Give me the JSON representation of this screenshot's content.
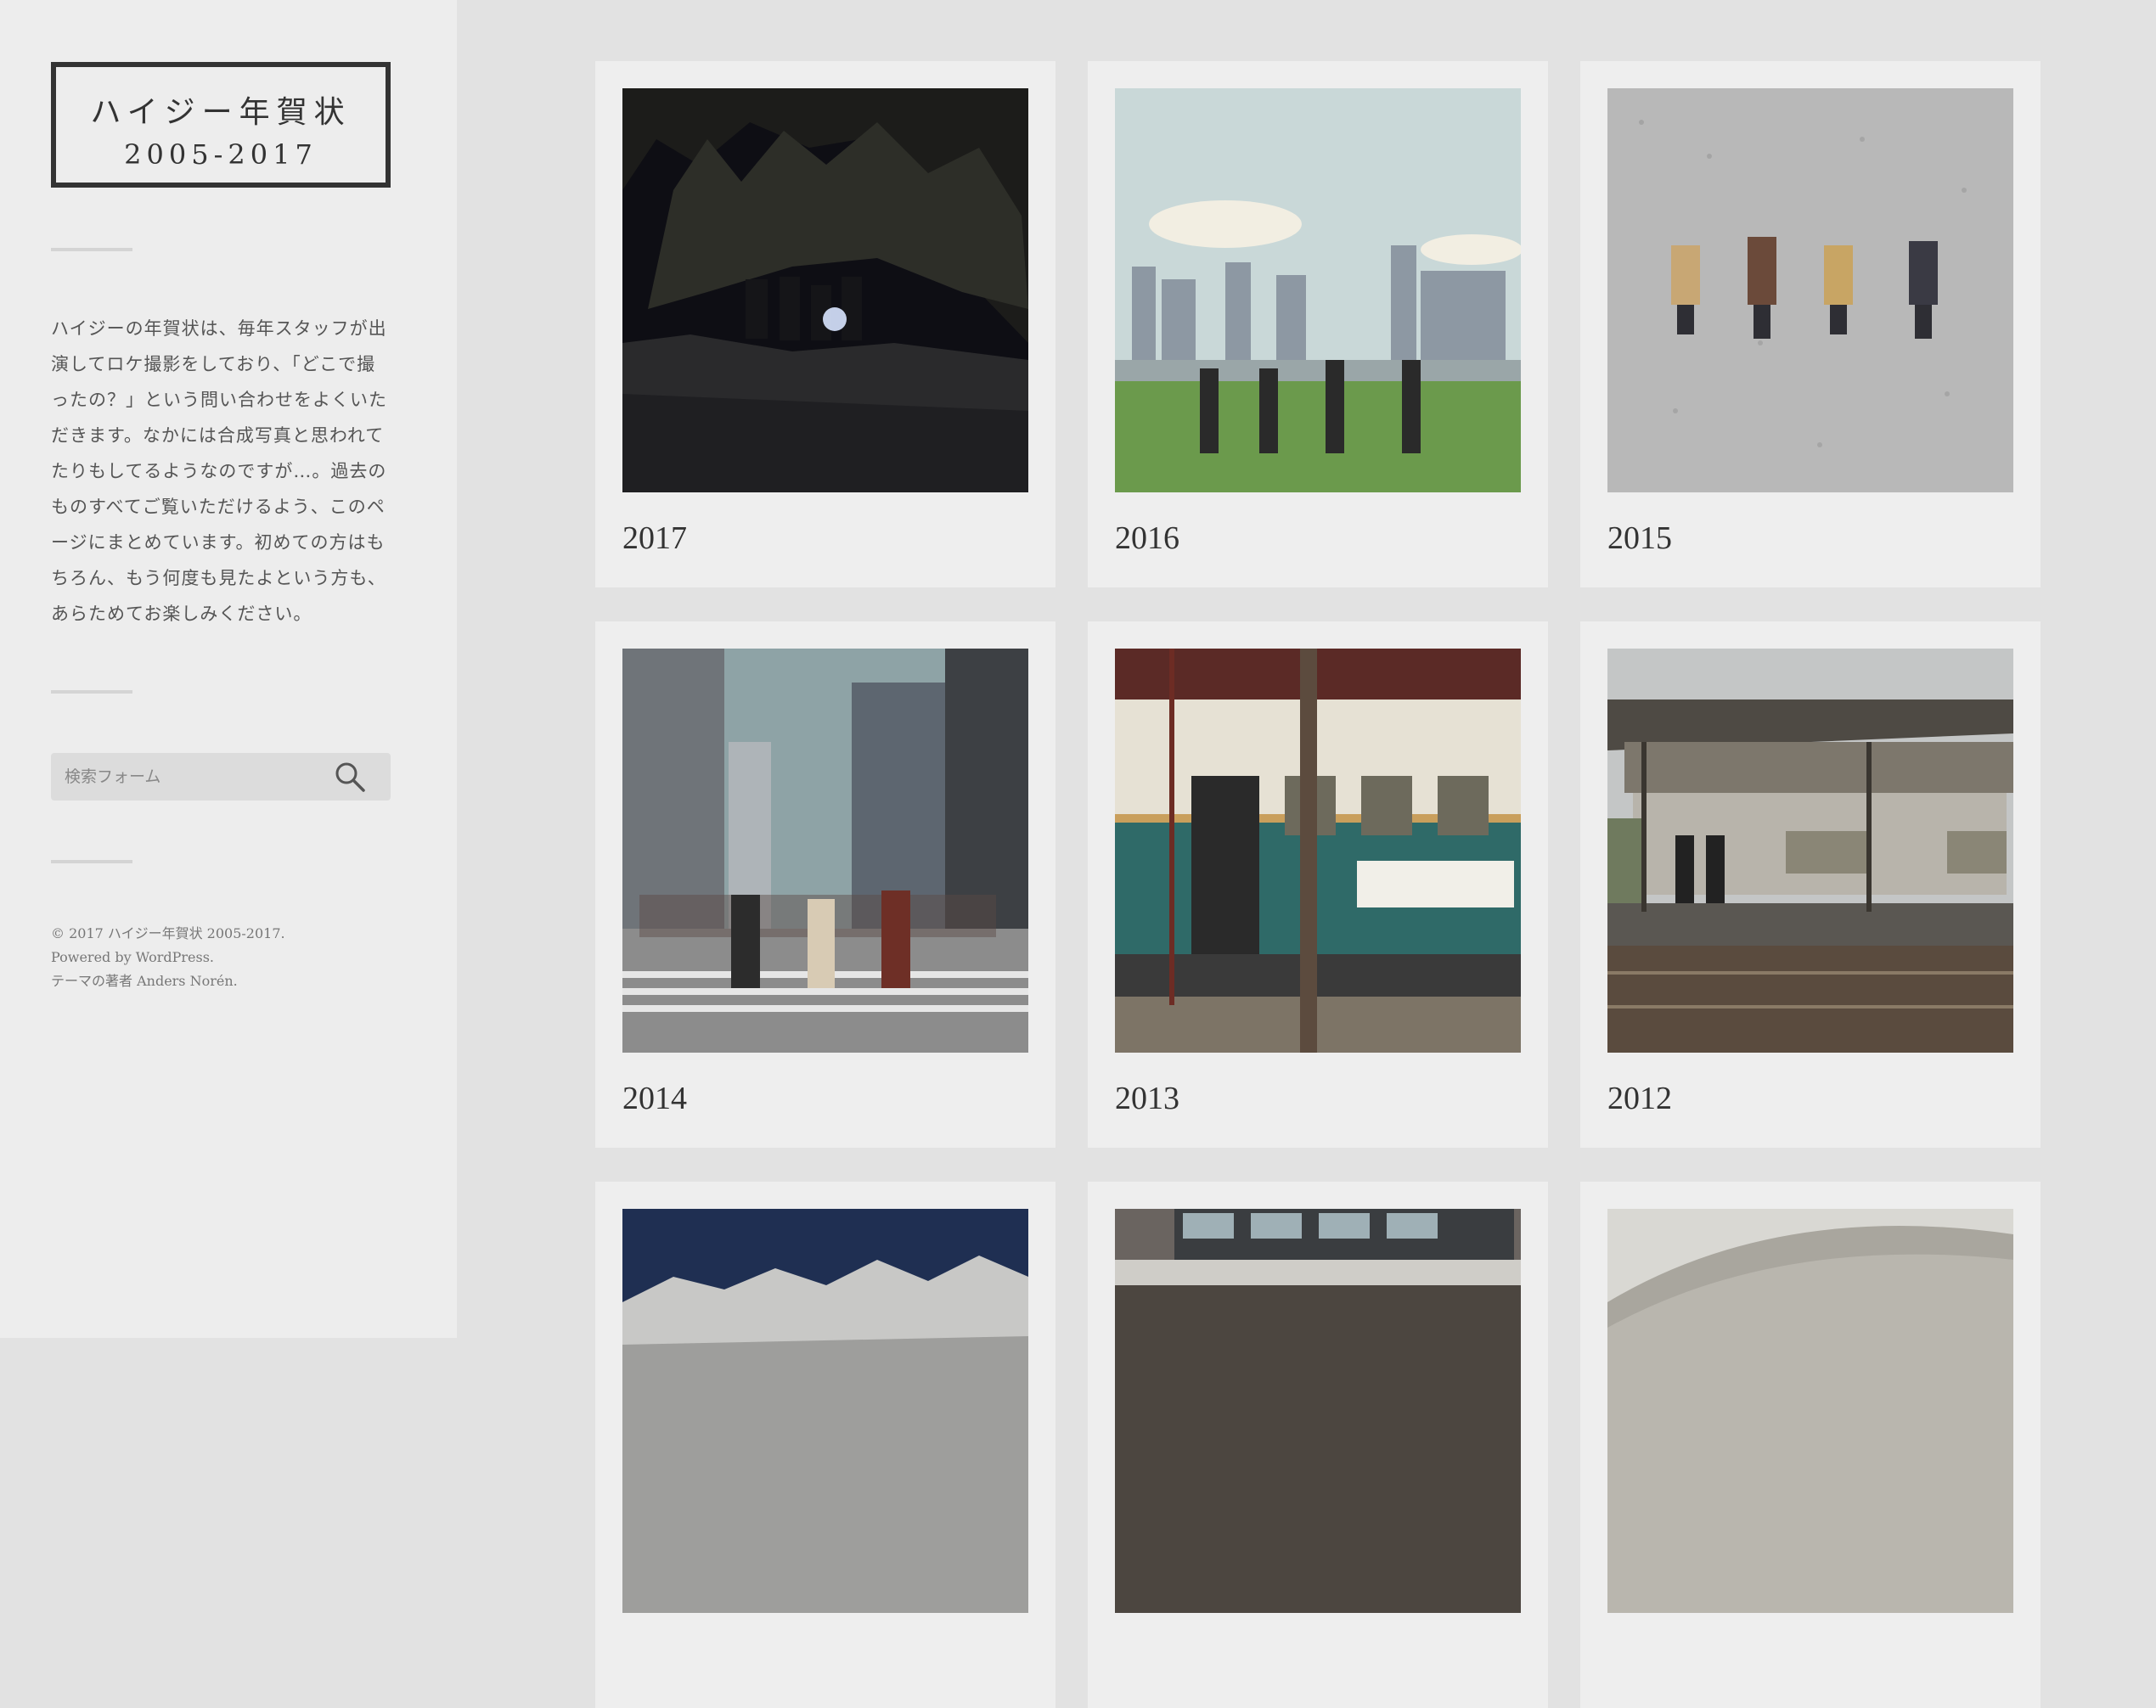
{
  "site": {
    "title_line1": "ハイジー年賀状",
    "title_line2": "2005-2017"
  },
  "sidebar": {
    "description": "ハイジーの年賀状は、毎年スタッフが出演してロケ撮影をしており、「どこで撮ったの？」という問い合わせをよくいただきます。なかには合成写真と思われてたりもしてるようなのですが…。過去のものすべてご覧いただけるよう、このページにまとめています。初めての方はもちろん、もう何度も見たよという方も、あらためてお楽しみください。",
    "search_placeholder": "検索フォーム",
    "search_icon": "search-icon"
  },
  "footer": {
    "copyright": "© 2017 ハイジー年賀状 2005-2017.",
    "powered": "Powered by WordPress.",
    "theme": "テーマの著者 Anders Norén."
  },
  "posts": [
    {
      "year": "2017"
    },
    {
      "year": "2016"
    },
    {
      "year": "2015"
    },
    {
      "year": "2014"
    },
    {
      "year": "2013"
    },
    {
      "year": "2012"
    },
    {
      "year": ""
    },
    {
      "year": ""
    },
    {
      "year": ""
    }
  ]
}
